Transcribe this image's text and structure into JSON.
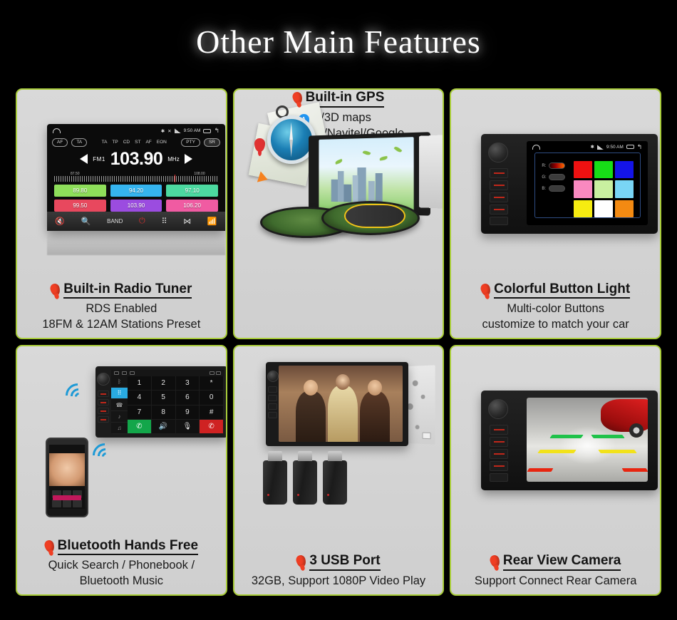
{
  "page": {
    "title": "Other Main Features",
    "background": "#000000",
    "card_border": "#a9cd3a",
    "card_bg": "#d4d4d4",
    "pin_color": "#ef3e23"
  },
  "cards": [
    {
      "id": "radio",
      "title": "Built-in Radio Tuner",
      "lines": [
        "RDS Enabled",
        "18FM & 12AM Stations Preset"
      ],
      "screen": {
        "status_time": "9:50 AM",
        "left_pills": [
          "AF",
          "TA"
        ],
        "mid_tags": [
          "TA",
          "TP",
          "CD",
          "ST",
          "AF",
          "EON"
        ],
        "right_pills": [
          "PTY",
          "SR"
        ],
        "band": "FM1",
        "frequency": "103.90",
        "unit": "MHz",
        "scale_min": "87.50",
        "scale_max": "108.00",
        "presets": [
          {
            "label": "89.80",
            "color": "#8ede5a"
          },
          {
            "label": "94.20",
            "color": "#35b4ef"
          },
          {
            "label": "97.10",
            "color": "#4cd9a0"
          },
          {
            "label": "99.50",
            "color": "#e8485e"
          },
          {
            "label": "103.90",
            "color": "#9b4ce0"
          },
          {
            "label": "106.20",
            "color": "#f05ba2"
          }
        ],
        "toolbar": [
          "mute-icon",
          "search-icon",
          "BAND",
          "power-icon",
          "keypad-icon",
          "shuffle-icon",
          "equalizer-icon"
        ],
        "band_label": "BAND"
      }
    },
    {
      "id": "gps",
      "title": "Built-in GPS",
      "lines": [
        "2D/3D maps",
        "Support iGo/Navitel/Google…"
      ],
      "screen": {
        "marker_label": "A"
      }
    },
    {
      "id": "button-light",
      "title": "Colorful Button Light",
      "lines": [
        "Multi-color Buttons",
        "customize to match your car"
      ],
      "screen": {
        "sliders": [
          {
            "label": "R:",
            "active": true
          },
          {
            "label": "G:",
            "active": false
          },
          {
            "label": "B:",
            "active": false
          }
        ],
        "swatches": [
          "#ee1111",
          "#17dd17",
          "#1414e8",
          "#f989c0",
          "#c9f0a0",
          "#79d5f5",
          "#f6ec11",
          "#ffffff",
          "#f38a12"
        ]
      }
    },
    {
      "id": "bluetooth",
      "title": "Bluetooth Hands Free",
      "lines": [
        "Quick Search / Phonebook /",
        "Bluetooth Music"
      ],
      "screen": {
        "rail": [
          "bt-icon",
          "keypad-icon",
          "phonebook-icon",
          "history-icon",
          "music-icon"
        ],
        "keys": [
          "1",
          "2",
          "3",
          "*",
          "4",
          "5",
          "6",
          "0",
          "7",
          "8",
          "9",
          "#"
        ],
        "call_label": "call-icon",
        "end_label": "hangup-icon",
        "action_row": [
          "volume-icon",
          "mic-icon",
          "refresh-icon"
        ]
      }
    },
    {
      "id": "usb",
      "title": "3 USB Port",
      "lines": [
        "32GB, Support 1080P Video Play"
      ],
      "screen": {}
    },
    {
      "id": "rear-camera",
      "title": "Rear View Camera",
      "lines": [
        "Support Connect Rear Camera"
      ],
      "screen": {
        "guide_colors": [
          "#1fc24a",
          "#f2e21a",
          "#e8250f"
        ]
      }
    }
  ]
}
